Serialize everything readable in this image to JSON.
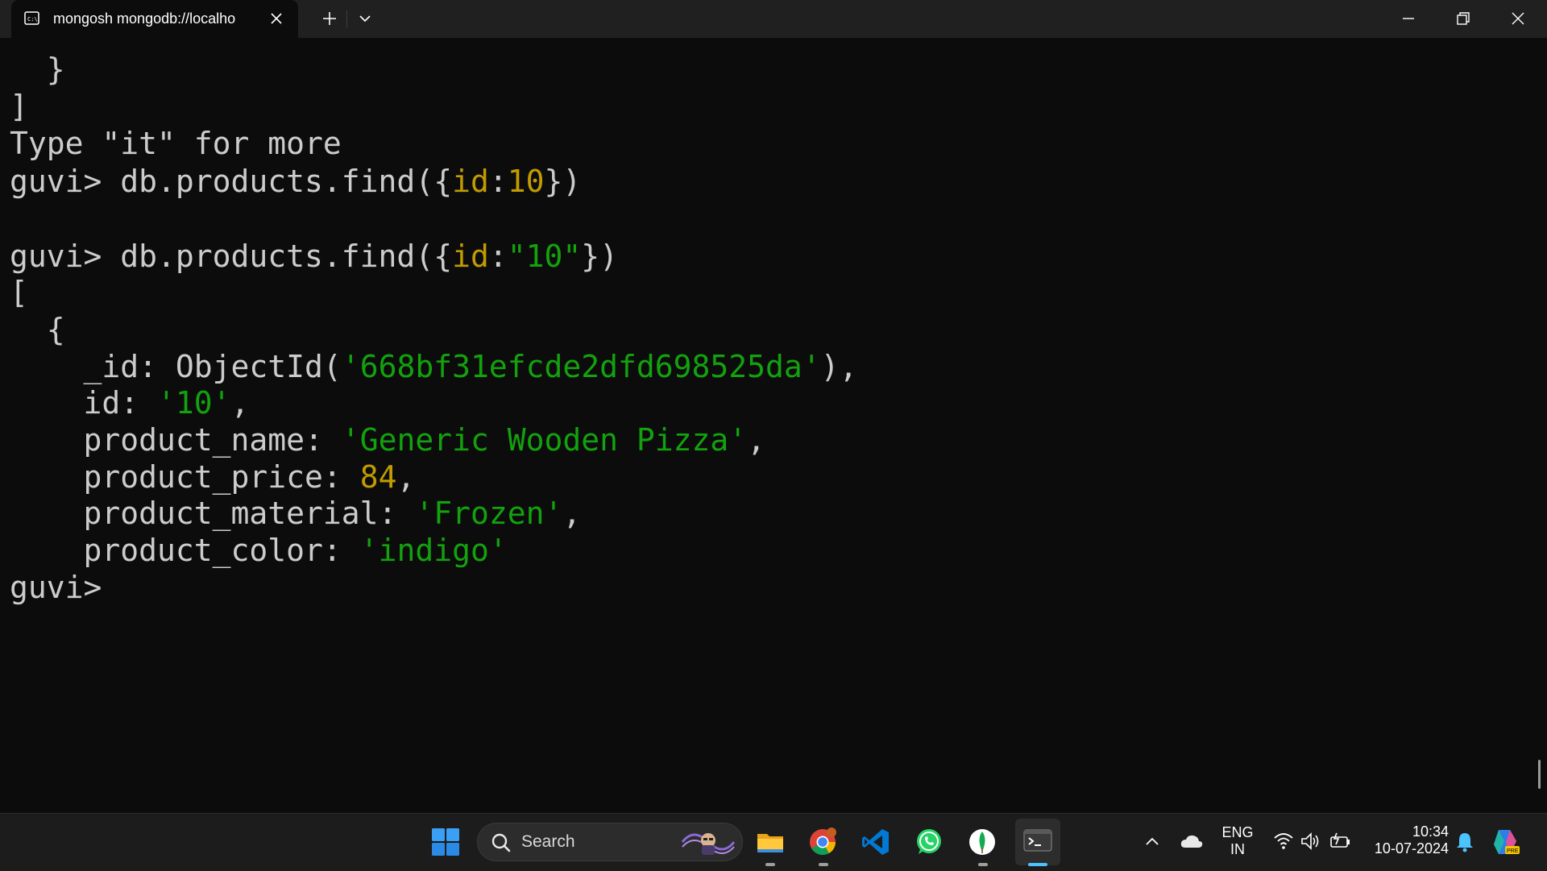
{
  "window": {
    "tab_title": "mongosh mongodb://localho",
    "tab_icon": "terminal-icon",
    "colors": {
      "titlebar": "#202020",
      "terminal_bg": "#0c0c0c",
      "default_text": "#cccccc",
      "key_and_number": "#c19c00",
      "string": "#13a10e"
    }
  },
  "terminal": {
    "lines": [
      [
        {
          "t": "  }",
          "c": "plain"
        }
      ],
      [
        {
          "t": "]",
          "c": "plain"
        }
      ],
      [
        {
          "t": "Type \"it\" for more",
          "c": "plain"
        }
      ],
      [
        {
          "t": "guvi> db.products.find({",
          "c": "plain"
        },
        {
          "t": "id",
          "c": "key"
        },
        {
          "t": ":",
          "c": "plain"
        },
        {
          "t": "10",
          "c": "num"
        },
        {
          "t": "})",
          "c": "plain"
        }
      ],
      [
        {
          "t": "",
          "c": "plain"
        }
      ],
      [
        {
          "t": "guvi> db.products.find({",
          "c": "plain"
        },
        {
          "t": "id",
          "c": "key"
        },
        {
          "t": ":",
          "c": "plain"
        },
        {
          "t": "\"10\"",
          "c": "str"
        },
        {
          "t": "})",
          "c": "plain"
        }
      ],
      [
        {
          "t": "[",
          "c": "plain"
        }
      ],
      [
        {
          "t": "  {",
          "c": "plain"
        }
      ],
      [
        {
          "t": "    _id: ObjectId(",
          "c": "plain"
        },
        {
          "t": "'668bf31efcde2dfd698525da'",
          "c": "str"
        },
        {
          "t": "),",
          "c": "plain"
        }
      ],
      [
        {
          "t": "    id: ",
          "c": "plain"
        },
        {
          "t": "'10'",
          "c": "str"
        },
        {
          "t": ",",
          "c": "plain"
        }
      ],
      [
        {
          "t": "    product_name: ",
          "c": "plain"
        },
        {
          "t": "'Generic Wooden Pizza'",
          "c": "str"
        },
        {
          "t": ",",
          "c": "plain"
        }
      ],
      [
        {
          "t": "    product_price: ",
          "c": "plain"
        },
        {
          "t": "84",
          "c": "num"
        },
        {
          "t": ",",
          "c": "plain"
        }
      ],
      [
        {
          "t": "    product_material: ",
          "c": "plain"
        },
        {
          "t": "'Frozen'",
          "c": "str"
        },
        {
          "t": ",",
          "c": "plain"
        }
      ],
      [
        {
          "t": "    product_color: ",
          "c": "plain"
        },
        {
          "t": "'indigo'",
          "c": "str"
        }
      ],
      [
        {
          "t": "guvi>",
          "c": "plain"
        }
      ]
    ]
  },
  "taskbar": {
    "search_label": "Search",
    "apps": [
      "start-icon",
      "file-explorer-icon",
      "chrome-icon",
      "vscode-icon",
      "whatsapp-icon",
      "mongodb-compass-icon",
      "terminal-icon"
    ],
    "tray": {
      "language_top": "ENG",
      "language_bottom": "IN",
      "time": "10:34",
      "date": "10-07-2024"
    }
  }
}
